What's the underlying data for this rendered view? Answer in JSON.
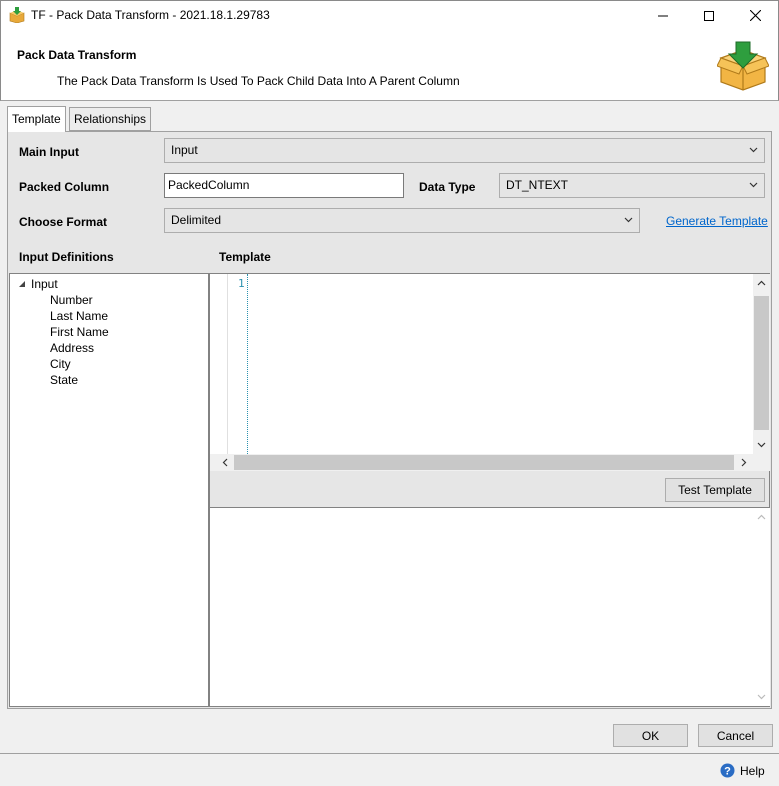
{
  "window": {
    "title": "TF - Pack Data Transform - 2021.18.1.29783",
    "controls": {
      "minimize": "minimize-icon",
      "maximize": "maximize-icon",
      "close": "close-icon"
    }
  },
  "header": {
    "title": "Pack Data Transform",
    "description": "The Pack Data Transform Is Used To Pack Child Data Into A Parent Column"
  },
  "tabs": [
    {
      "label": "Template",
      "selected": true
    },
    {
      "label": "Relationships",
      "selected": false
    }
  ],
  "form": {
    "main_input": {
      "label": "Main Input",
      "value": "Input"
    },
    "packed_column": {
      "label": "Packed Column",
      "value": "PackedColumn"
    },
    "data_type": {
      "label": "Data Type",
      "value": "DT_NTEXT"
    },
    "choose_format": {
      "label": "Choose Format",
      "value": "Delimited"
    },
    "generate_template_link": "Generate Template"
  },
  "input_definitions": {
    "heading": "Input Definitions",
    "root": "Input",
    "children": [
      "Number",
      "Last Name",
      "First Name",
      "Address",
      "City",
      "State"
    ]
  },
  "template": {
    "heading": "Template",
    "line_number": "1",
    "test_button": "Test Template"
  },
  "footer": {
    "ok": "OK",
    "cancel": "Cancel",
    "help": "Help"
  },
  "colors": {
    "link": "#0066cc",
    "line_number": "#2b91af",
    "logo_box": "#f2b544",
    "logo_arrow": "#2e9e3e"
  }
}
